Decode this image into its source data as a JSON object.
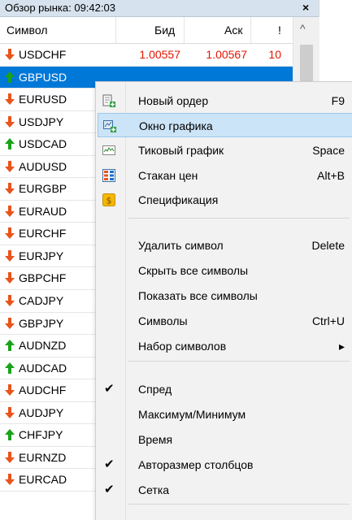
{
  "window": {
    "title": "Обзор рынка: 09:42:03",
    "close_label": "×"
  },
  "table": {
    "headers": {
      "symbol": "Символ",
      "bid": "Бид",
      "ask": "Аск",
      "spread": "!"
    },
    "rows": [
      {
        "symbol": "USDCHF",
        "dir": "down",
        "bid": "1.00557",
        "ask": "1.00567",
        "spread": "10"
      },
      {
        "symbol": "GBPUSD",
        "dir": "up",
        "selected": true
      },
      {
        "symbol": "EURUSD",
        "dir": "down"
      },
      {
        "symbol": "USDJPY",
        "dir": "down"
      },
      {
        "symbol": "USDCAD",
        "dir": "up"
      },
      {
        "symbol": "AUDUSD",
        "dir": "down"
      },
      {
        "symbol": "EURGBP",
        "dir": "down"
      },
      {
        "symbol": "EURAUD",
        "dir": "down"
      },
      {
        "symbol": "EURCHF",
        "dir": "down"
      },
      {
        "symbol": "EURJPY",
        "dir": "down"
      },
      {
        "symbol": "GBPCHF",
        "dir": "down"
      },
      {
        "symbol": "CADJPY",
        "dir": "down"
      },
      {
        "symbol": "GBPJPY",
        "dir": "down"
      },
      {
        "symbol": "AUDNZD",
        "dir": "up"
      },
      {
        "symbol": "AUDCAD",
        "dir": "up"
      },
      {
        "symbol": "AUDCHF",
        "dir": "down"
      },
      {
        "symbol": "AUDJPY",
        "dir": "down"
      },
      {
        "symbol": "CHFJPY",
        "dir": "up"
      },
      {
        "symbol": "EURNZD",
        "dir": "down"
      },
      {
        "symbol": "EURCAD",
        "dir": "down"
      }
    ]
  },
  "colors": {
    "up": "#1aa31a",
    "down": "#e8541c",
    "selection": "#0078d7",
    "menu_highlight": "#cce4f7"
  },
  "menu": {
    "items": [
      {
        "label": "Новый ордер",
        "shortcut": "F9",
        "icon": "new-order-icon"
      },
      {
        "label": "Окно графика",
        "shortcut": "",
        "icon": "chart-window-icon",
        "highlighted": true
      },
      {
        "label": "Тиковый график",
        "shortcut": "Space",
        "icon": "tick-chart-icon"
      },
      {
        "label": "Стакан цен",
        "shortcut": "Alt+B",
        "icon": "depth-of-market-icon"
      },
      {
        "label": "Спецификация",
        "shortcut": "",
        "icon": "specification-icon"
      },
      {
        "label": "Удалить символ",
        "shortcut": "Delete"
      },
      {
        "label": "Скрыть все символы",
        "shortcut": ""
      },
      {
        "label": "Показать все символы",
        "shortcut": ""
      },
      {
        "label": "Символы",
        "shortcut": "Ctrl+U"
      },
      {
        "label": "Набор символов",
        "shortcut": "",
        "submenu": true
      },
      {
        "label": "Спред",
        "checked": true
      },
      {
        "label": "Максимум/Минимум",
        "checked": false
      },
      {
        "label": "Время",
        "checked": false
      },
      {
        "label": "Авторазмер столбцов",
        "checked": true
      },
      {
        "label": "Сетка",
        "checked": true
      }
    ],
    "check_glyph": "✔",
    "submenu_glyph": "▸"
  }
}
